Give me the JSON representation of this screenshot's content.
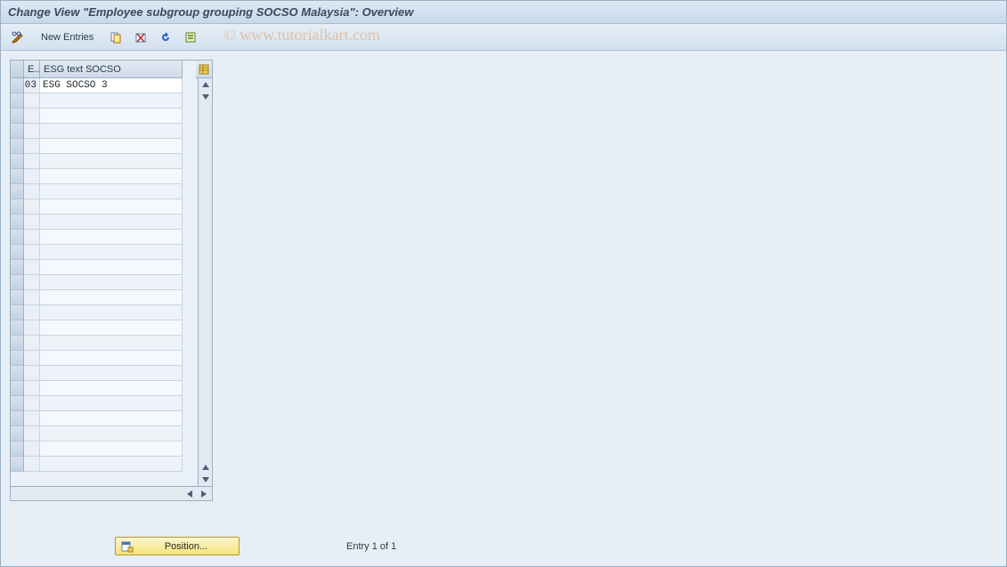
{
  "title": "Change View \"Employee subgroup grouping SOCSO Malaysia\": Overview",
  "toolbar": {
    "new_entries_label": "New Entries"
  },
  "watermark": "© www.tutorialkart.com",
  "grid": {
    "col1_header": "E..",
    "col2_header": "ESG text SOCSO",
    "rows": [
      {
        "c1": "03",
        "c2": "ESG SOCSO 3"
      }
    ],
    "empty_rows": 25
  },
  "footer": {
    "position_label": "Position...",
    "status": "Entry 1 of 1"
  }
}
